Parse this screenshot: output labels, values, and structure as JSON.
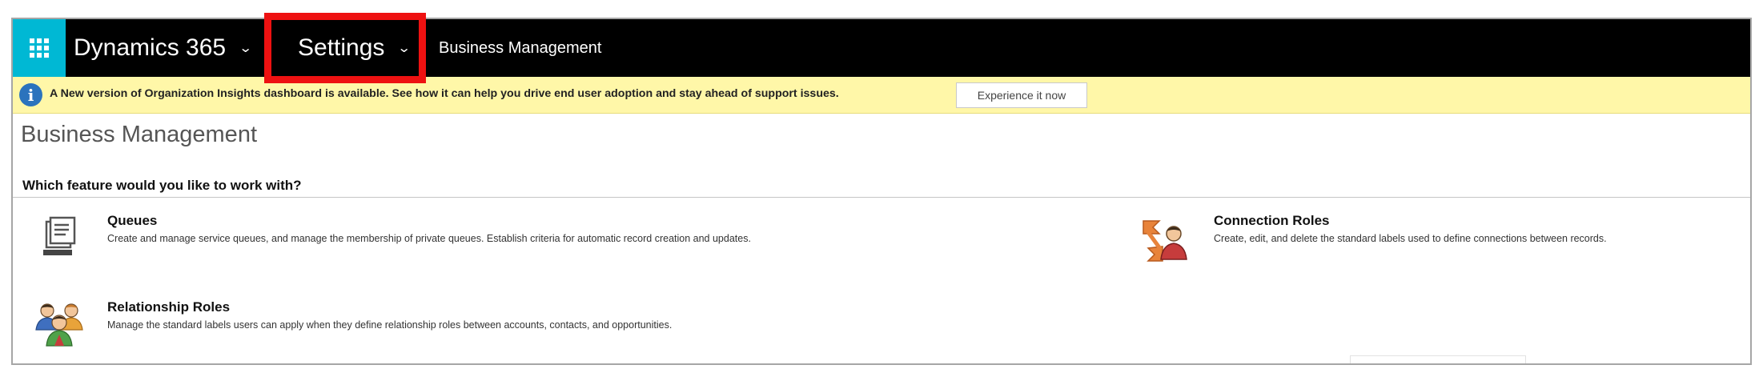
{
  "topnav": {
    "app_name": "Dynamics 365",
    "area": "Settings",
    "breadcrumb": "Business Management",
    "chevron": "⌄"
  },
  "banner": {
    "info_glyph": "i",
    "message": "A New version of Organization Insights dashboard is available. See how it can help you drive end user adoption and stay ahead of support issues.",
    "button_label": "Experience it now"
  },
  "page": {
    "title": "Business Management",
    "question": "Which feature would you like to work with?"
  },
  "features": [
    {
      "title": "Queues",
      "description": "Create and manage service queues, and manage the membership of private queues. Establish criteria for automatic record creation and updates.",
      "icon": "queue-icon"
    },
    {
      "title": "Connection Roles",
      "description": "Create, edit, and delete the standard labels used to define connections between records.",
      "icon": "connection-roles-icon"
    },
    {
      "title": "Relationship Roles",
      "description": "Manage the standard labels users can apply when they define relationship roles between accounts, contacts, and opportunities.",
      "icon": "relationship-roles-icon"
    }
  ],
  "colors": {
    "launcher": "#00b8d4",
    "nav_bg": "#000000",
    "banner_bg": "#fff7a8",
    "highlight": "#ee1111",
    "info": "#2b73bd"
  }
}
